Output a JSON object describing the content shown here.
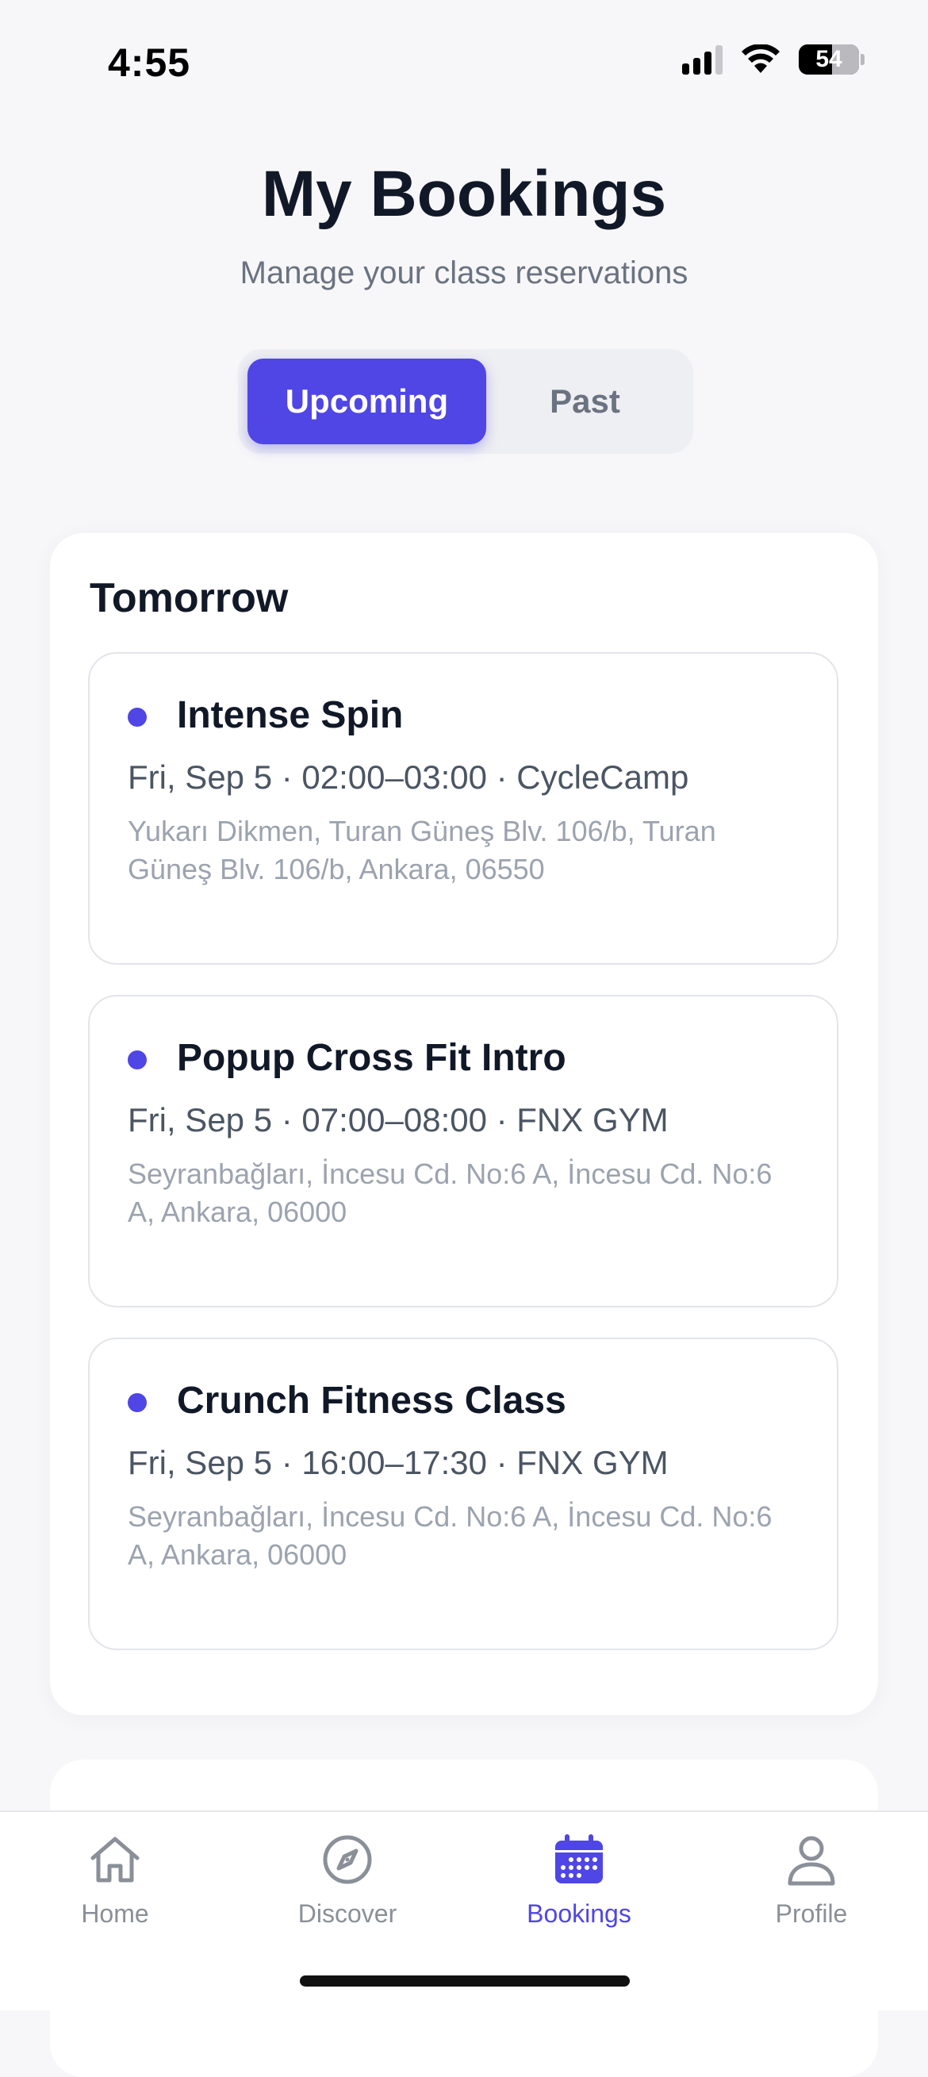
{
  "status_bar": {
    "time": "4:55",
    "battery": "54"
  },
  "header": {
    "title": "My Bookings",
    "subtitle": "Manage your class reservations"
  },
  "segments": {
    "upcoming": "Upcoming",
    "past": "Past",
    "selected": "Upcoming"
  },
  "section": {
    "title": "Tomorrow",
    "bookings": [
      {
        "name": "Intense Spin",
        "meta": "Fri, Sep 5 · 02:00–03:00 · CycleCamp",
        "address": "Yukarı Dikmen, Turan Güneş Blv. 106/b, Turan Güneş Blv. 106/b, Ankara, 06550"
      },
      {
        "name": "Popup Cross Fit Intro",
        "meta": "Fri, Sep 5 · 07:00–08:00 · FNX GYM",
        "address": "Seyranbağları, İncesu Cd. No:6 A, İncesu Cd. No:6 A, Ankara, 06000"
      },
      {
        "name": "Crunch Fitness Class",
        "meta": "Fri, Sep 5 · 16:00–17:30 · FNX GYM",
        "address": "Seyranbağları, İncesu Cd. No:6 A, İncesu Cd. No:6 A, Ankara, 06000"
      }
    ]
  },
  "tab_bar": {
    "items": [
      {
        "label": "Home",
        "icon": "home-icon"
      },
      {
        "label": "Discover",
        "icon": "compass-icon"
      },
      {
        "label": "Bookings",
        "icon": "calendar-icon"
      },
      {
        "label": "Profile",
        "icon": "person-icon"
      }
    ],
    "active": "Bookings"
  },
  "colors": {
    "accent": "#4f46e5",
    "text": "#111827",
    "muted": "#6b7280",
    "background": "#f7f7f9"
  }
}
